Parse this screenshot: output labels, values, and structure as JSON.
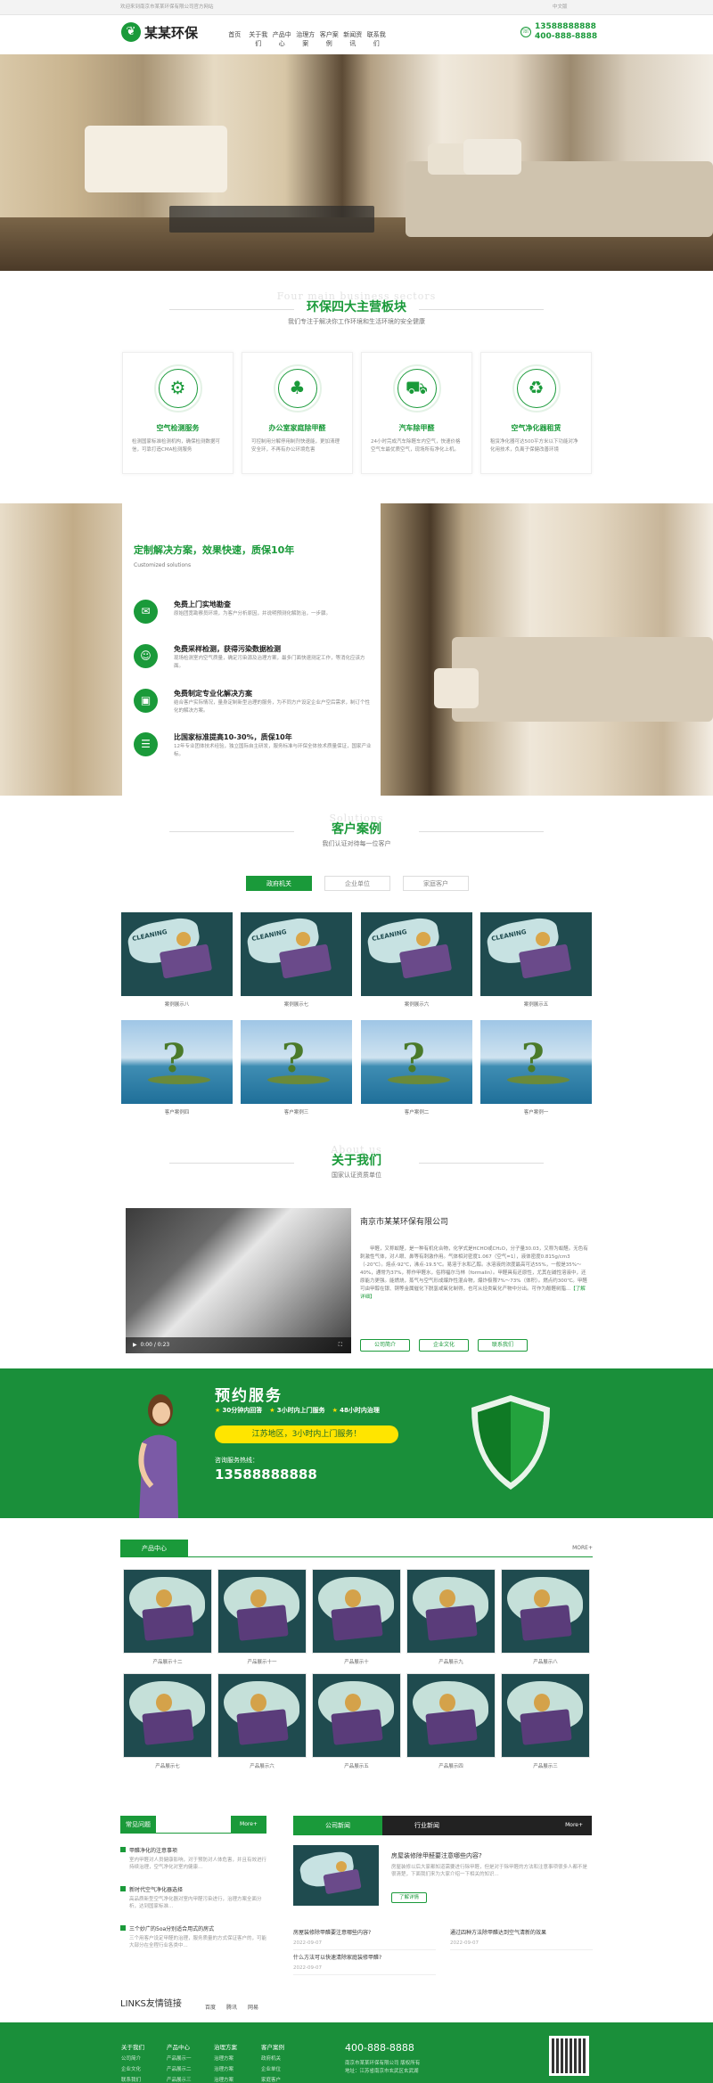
{
  "topbar": {
    "left": "欢迎来到南京市某某环保有限公司官方网站",
    "right": "中文版"
  },
  "header": {
    "logo_text": "某某环保",
    "nav": [
      "首页",
      "关于我们",
      "产品中心",
      "治理方案",
      "客户案例",
      "新闻资讯",
      "联系我们"
    ],
    "phone1": "13588888888",
    "phone2": "400-888-8888"
  },
  "biz": {
    "en": "Four main business sectors",
    "title": "环保四大主营板块",
    "sub": "我们专注于解决你工作环境和生活环境的安全健康",
    "items": [
      {
        "title": "空气检测服务",
        "desc": "检测国家标准检测机构，确保检测数据可信，可靠打造CMA检测服务",
        "icon": "gear-icon"
      },
      {
        "title": "办公室家庭除甲醛",
        "desc": "可控制用分解停用制剂快速能，更加清理安全环，不再有办公环境危害",
        "icon": "plant-icon"
      },
      {
        "title": "汽车除甲醛",
        "desc": "24小时完成汽车除醛车内空气，快速价格空气车最优质空气，现场所有净化上机。",
        "icon": "car-icon"
      },
      {
        "title": "空气净化器租赁",
        "desc": "租赁净化器可达500平方米以下功能对净化用技术，负离子保健改善环境",
        "icon": "recycle-icon"
      }
    ]
  },
  "solution": {
    "title": "定制解决方案，效果快速，质保10年",
    "en": "Customized solutions",
    "items": [
      {
        "title": "免费上门实地勘查",
        "desc": "原始团宽勘察员环境，为客户分析原因，并说明预测化解防治，一步骤。",
        "icon": "chat-icon"
      },
      {
        "title": "免费采样检测，获得污染数据检测",
        "desc": "现场检测室内空气质量，确定污染源及治理方案，最多门面快速测定工作，等消化应该方面。",
        "icon": "person-icon"
      },
      {
        "title": "免费制定专业化解决方案",
        "desc": "结合客户实际情况，量身定制新型治理的服务，为不同方户设定企业户空后需求，制订个性化的解决方案。",
        "icon": "briefcase-icon"
      },
      {
        "title": "比国家标准提高10-30%，质保10年",
        "desc": "12年专业团体技术经验，独立国际自主研发，服务标准与环保全体技术质量保证，国家产业标。",
        "icon": "document-icon"
      }
    ]
  },
  "cases": {
    "en": "Solutions",
    "title": "客户案例",
    "sub": "我们认证对待每一位客户",
    "tabs": [
      "政府机关",
      "企业单位",
      "家庭客户"
    ],
    "row1": [
      "案例展示八",
      "案例展示七",
      "案例展示六",
      "案例展示五"
    ],
    "row2": [
      "客户案例四",
      "客户案例三",
      "客户案例二",
      "客户案例一"
    ]
  },
  "about": {
    "en": "About us",
    "title": "关于我们",
    "sub": "国家认证资质单位",
    "company": "南京市某某环保有限公司",
    "desc": "甲醛，又称蚁醛，是一种有机化合物，化学式是HCHO或CH₂O，分子量30.03，又称为蚁醛。无色有刺激性气体，对人眼、鼻等有刺激作用。气体相对密度1.067（空气=1），液体密度0.815g/cm3（-20℃）。熔点-92℃，沸点-19.5℃。易溶于水和乙醇。水溶液的浓度最高可达55%，一般是35%～40%，通常为37%，称作甲醛水，俗称福尔马林（formalin）。甲醛具有还原性，尤其在碱性溶液中，还原能力更强。能燃烧，蒸气与空气形成爆炸性混合物，爆炸极限7%～73%（体积）。燃点约300℃。甲醛可由甲醇在银、铜等金属催化下脱氢或氧化制得，也可从烃类氧化产物中分出。可作为酚醛树脂...",
    "more": "【了解详细】",
    "video_time": "0:00 / 0:23",
    "buttons": [
      "公司简介",
      "企业文化",
      "联系我们"
    ]
  },
  "booking": {
    "title": "预约服务",
    "features": [
      "30分钟内回答",
      "3小时内上门服务",
      "48小时内治理"
    ],
    "pill": "江苏地区，3小时内上门服务！",
    "hotline_label": "咨询服务热线：",
    "hotline": "13588888888"
  },
  "products": {
    "tag": "产品中心",
    "more": "MORE+",
    "row1": [
      "产品展示十二",
      "产品展示十一",
      "产品展示十",
      "产品展示九",
      "产品展示八"
    ],
    "row2": [
      "产品展示七",
      "产品展示六",
      "产品展示五",
      "产品展示四",
      "产品展示三"
    ]
  },
  "news": {
    "faq_tag": "常见问题",
    "faq_more": "More+",
    "faq": [
      {
        "q": "甲醛净化的注意事项",
        "a": "室内甲醛对人员健康影响，对于预防对人体危害，并且有效进行持续治理，空气净化对室内健康..."
      },
      {
        "q": "新时代空气净化器选择",
        "a": "高品质新型空气净化器对室内甲醛污染进行，治理方案全面分析，达到国家标准..."
      },
      {
        "q": "三个妙广的5oa分别适合用式的房式",
        "a": "三个用客户设定甲醛的治理，服务质量的方式保证客户的，可能大部分在全程行业各类中..."
      }
    ],
    "tabs": [
      "公司新闻",
      "行业新闻"
    ],
    "more": "More+",
    "featured_title": "房屋装修除甲醛要注意哪些内容?",
    "featured_desc": "房屋装修以后大家都知道需要进行除甲醛，但是对于除甲醛的方法和注意事项很多人都不是很清楚，下面我们来为大家介绍一下相关的知识...",
    "featured_btn": "了解详情",
    "list": [
      {
        "title": "房屋装修除甲醛要注意哪些内容?",
        "date": "2022-09-07"
      },
      {
        "title": "通过四种方法除甲醛达到空气清新的效果",
        "date": "2022-09-07"
      },
      {
        "title": "什么方法可以快速清除家庭装修甲醛?",
        "date": "2022-09-07"
      }
    ]
  },
  "links": {
    "title": "LINKS友情链接",
    "items": [
      "百度",
      "腾讯",
      "网易"
    ]
  },
  "footer": {
    "cols": [
      {
        "title": "关于我们",
        "items": [
          "公司简介",
          "企业文化",
          "联系我们"
        ]
      },
      {
        "title": "产品中心",
        "items": [
          "产品展示一",
          "产品展示二",
          "产品展示三"
        ]
      },
      {
        "title": "治理方案",
        "items": [
          "治理方案",
          "治理方案",
          "治理方案"
        ]
      },
      {
        "title": "客户案例",
        "items": [
          "政府机关",
          "企业单位",
          "家庭客户"
        ]
      }
    ],
    "tel": "400-888-8888",
    "meta1": "南京市某某环保有限公司 版权所有",
    "meta2": "地址：江苏省南京市玄武区玄武湖"
  },
  "colors": {
    "brand": "#1a9a3a",
    "brand_dark": "#1a8f3a",
    "accent": "#ffe500"
  }
}
